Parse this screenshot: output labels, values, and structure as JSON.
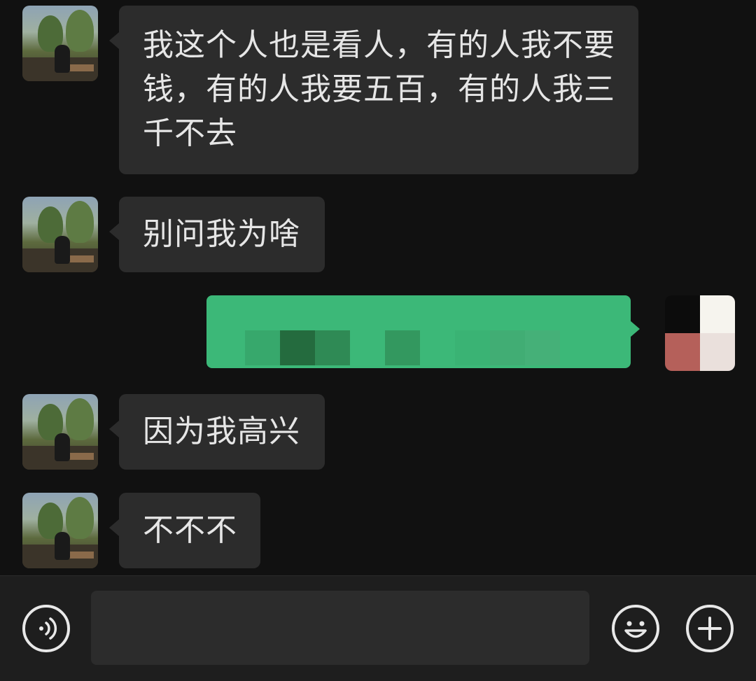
{
  "messages": [
    {
      "sender": "other",
      "lines": [
        "我这个人也是看人，有的人我不要",
        "钱，有的人我要五百，有的人我三",
        "千不去"
      ]
    },
    {
      "sender": "other",
      "lines": [
        "别问我为啥"
      ]
    },
    {
      "sender": "self",
      "content_state": "pixelated"
    },
    {
      "sender": "other",
      "lines": [
        "因为我高兴"
      ]
    },
    {
      "sender": "other",
      "lines": [
        "不不不"
      ]
    }
  ],
  "input_bar": {
    "message_input_value": "",
    "voice_icon": "voice-wave-icon",
    "emoji_icon": "smiley-icon",
    "plus_icon": "plus-icon"
  },
  "colors": {
    "background": "#111111",
    "received_bubble": "#2c2c2c",
    "sent_bubble": "#3cb878",
    "text": "#e6e6e6"
  }
}
